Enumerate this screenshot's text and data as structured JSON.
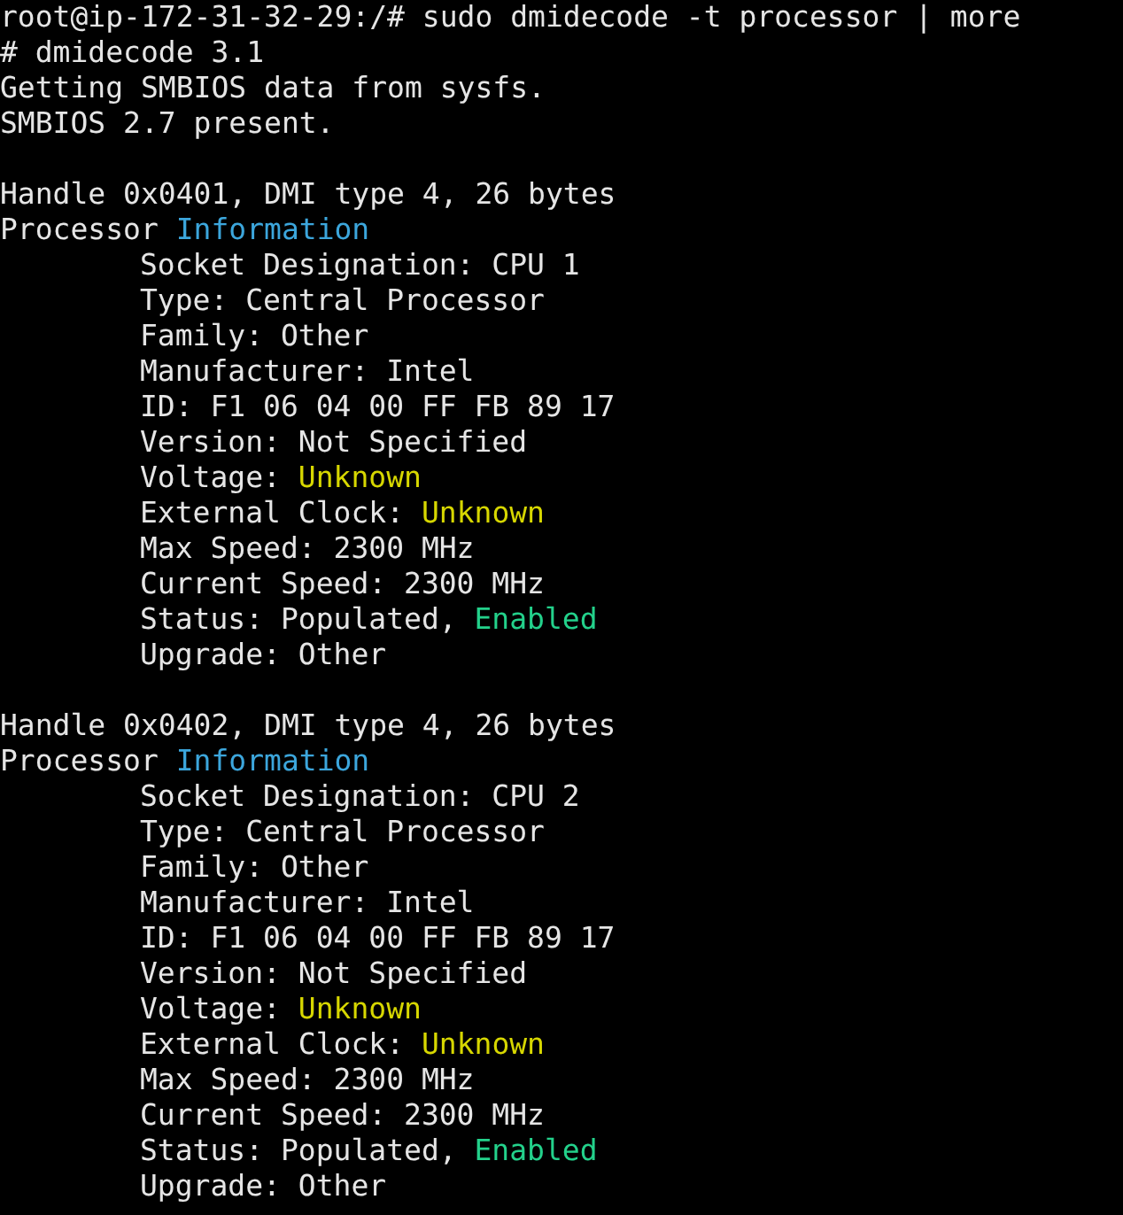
{
  "terminal": {
    "blocks": [
      {
        "lines": [
          {
            "indented": false,
            "segments": [
              {
                "text": "root@ip-172-31-32-29:/# sudo dmidecode -t processor | more",
                "color": "#e5e5e5"
              }
            ]
          },
          {
            "indented": false,
            "segments": [
              {
                "text": "# dmidecode 3.1",
                "color": "#e5e5e5"
              }
            ]
          },
          {
            "indented": false,
            "segments": [
              {
                "text": "Getting SMBIOS data from sysfs.",
                "color": "#e5e5e5"
              }
            ]
          },
          {
            "indented": false,
            "segments": [
              {
                "text": "SMBIOS 2.7 present.",
                "color": "#e5e5e5"
              }
            ]
          }
        ]
      },
      {
        "lines": [
          {
            "indented": false,
            "segments": [
              {
                "text": "Handle 0x0401, DMI type 4, 26 bytes",
                "color": "#e5e5e5"
              }
            ]
          },
          {
            "indented": false,
            "segments": [
              {
                "text": "Processor ",
                "color": "#e5e5e5"
              },
              {
                "text": "Information",
                "color": "#3ca6dc"
              }
            ]
          },
          {
            "indented": true,
            "segments": [
              {
                "text": "Socket Designation: CPU 1",
                "color": "#e5e5e5"
              }
            ]
          },
          {
            "indented": true,
            "segments": [
              {
                "text": "Type: Central Processor",
                "color": "#e5e5e5"
              }
            ]
          },
          {
            "indented": true,
            "segments": [
              {
                "text": "Family: Other",
                "color": "#e5e5e5"
              }
            ]
          },
          {
            "indented": true,
            "segments": [
              {
                "text": "Manufacturer: Intel",
                "color": "#e5e5e5"
              }
            ]
          },
          {
            "indented": true,
            "segments": [
              {
                "text": "ID: F1 06 04 00 FF FB 89 17",
                "color": "#e5e5e5"
              }
            ]
          },
          {
            "indented": true,
            "segments": [
              {
                "text": "Version: Not Specified",
                "color": "#e5e5e5"
              }
            ]
          },
          {
            "indented": true,
            "segments": [
              {
                "text": "Voltage: ",
                "color": "#e5e5e5"
              },
              {
                "text": "Unknown",
                "color": "#d7d700"
              }
            ]
          },
          {
            "indented": true,
            "segments": [
              {
                "text": "External Clock: ",
                "color": "#e5e5e5"
              },
              {
                "text": "Unknown",
                "color": "#d7d700"
              }
            ]
          },
          {
            "indented": true,
            "segments": [
              {
                "text": "Max Speed: 2300 MHz",
                "color": "#e5e5e5"
              }
            ]
          },
          {
            "indented": true,
            "segments": [
              {
                "text": "Current Speed: 2300 MHz",
                "color": "#e5e5e5"
              }
            ]
          },
          {
            "indented": true,
            "segments": [
              {
                "text": "Status: Populated, ",
                "color": "#e5e5e5"
              },
              {
                "text": "Enabled",
                "color": "#23d18b"
              }
            ]
          },
          {
            "indented": true,
            "segments": [
              {
                "text": "Upgrade: Other",
                "color": "#e5e5e5"
              }
            ]
          }
        ]
      },
      {
        "lines": [
          {
            "indented": false,
            "segments": [
              {
                "text": "Handle 0x0402, DMI type 4, 26 bytes",
                "color": "#e5e5e5"
              }
            ]
          },
          {
            "indented": false,
            "segments": [
              {
                "text": "Processor ",
                "color": "#e5e5e5"
              },
              {
                "text": "Information",
                "color": "#3ca6dc"
              }
            ]
          },
          {
            "indented": true,
            "segments": [
              {
                "text": "Socket Designation: CPU 2",
                "color": "#e5e5e5"
              }
            ]
          },
          {
            "indented": true,
            "segments": [
              {
                "text": "Type: Central Processor",
                "color": "#e5e5e5"
              }
            ]
          },
          {
            "indented": true,
            "segments": [
              {
                "text": "Family: Other",
                "color": "#e5e5e5"
              }
            ]
          },
          {
            "indented": true,
            "segments": [
              {
                "text": "Manufacturer: Intel",
                "color": "#e5e5e5"
              }
            ]
          },
          {
            "indented": true,
            "segments": [
              {
                "text": "ID: F1 06 04 00 FF FB 89 17",
                "color": "#e5e5e5"
              }
            ]
          },
          {
            "indented": true,
            "segments": [
              {
                "text": "Version: Not Specified",
                "color": "#e5e5e5"
              }
            ]
          },
          {
            "indented": true,
            "segments": [
              {
                "text": "Voltage: ",
                "color": "#e5e5e5"
              },
              {
                "text": "Unknown",
                "color": "#d7d700"
              }
            ]
          },
          {
            "indented": true,
            "segments": [
              {
                "text": "External Clock: ",
                "color": "#e5e5e5"
              },
              {
                "text": "Unknown",
                "color": "#d7d700"
              }
            ]
          },
          {
            "indented": true,
            "segments": [
              {
                "text": "Max Speed: 2300 MHz",
                "color": "#e5e5e5"
              }
            ]
          },
          {
            "indented": true,
            "segments": [
              {
                "text": "Current Speed: 2300 MHz",
                "color": "#e5e5e5"
              }
            ]
          },
          {
            "indented": true,
            "segments": [
              {
                "text": "Status: Populated, ",
                "color": "#e5e5e5"
              },
              {
                "text": "Enabled",
                "color": "#23d18b"
              }
            ]
          },
          {
            "indented": true,
            "segments": [
              {
                "text": "Upgrade: Other",
                "color": "#e5e5e5"
              }
            ]
          }
        ]
      }
    ]
  }
}
